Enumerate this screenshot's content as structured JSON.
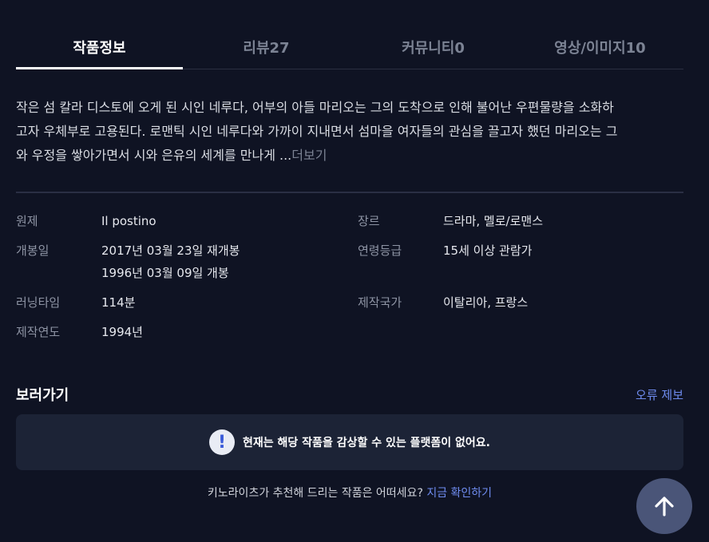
{
  "tabs": [
    {
      "label": "작품정보",
      "active": true
    },
    {
      "label": "리뷰27",
      "active": false
    },
    {
      "label": "커뮤니티0",
      "active": false
    },
    {
      "label": "영상/이미지10",
      "active": false
    }
  ],
  "synopsis": {
    "lines": [
      "작은 섬 칼라 디스토에 오게 된 시인 네루다, 어부의 아들 마리오는 그의 도착으로 인해 불어난 우편물량을 소화하",
      "고자 우체부로 고용된다. 로맨틱 시인 네루다와 가까이 지내면서 섬마을 여자들의 관심을 끌고자 했던 마리오는 그",
      "와 우정을 쌓아가면서 시와 은유의 세계를 만나게 ..."
    ],
    "more_label": "더보기"
  },
  "info": {
    "left": [
      {
        "key": "원제",
        "values": [
          "Il postino"
        ]
      },
      {
        "key": "개봉일",
        "values": [
          "2017년 03월 23일 재개봉",
          "1996년 03월 09일 개봉"
        ]
      },
      {
        "key": "러닝타임",
        "values": [
          "114분"
        ]
      },
      {
        "key": "제작연도",
        "values": [
          "1994년"
        ]
      }
    ],
    "right": [
      {
        "key": "장르",
        "values": [
          "드라마, 멜로/로맨스"
        ]
      },
      {
        "key": "연령등급",
        "values": [
          "15세 이상 관람가"
        ]
      },
      {
        "key": "제작국가",
        "values": [
          "이탈리아, 프랑스"
        ]
      }
    ]
  },
  "watch": {
    "title": "보러가기",
    "report_label": "오류 제보",
    "notice_icon": "exclamation-icon",
    "notice_text": "현재는 해당 작품을 감상할 수 있는 플랫폼이 없어요."
  },
  "recommend": {
    "text": "키노라이츠가 추천해 드리는 작품은 어떠세요?",
    "link_label": "지금 확인하기"
  },
  "scroll_top": {
    "icon": "arrow-up-icon"
  },
  "colors": {
    "background": "#0f1323",
    "accent": "#6f8cf0",
    "notice_bg": "#1c2336",
    "scroll_button": "#4a5578"
  }
}
